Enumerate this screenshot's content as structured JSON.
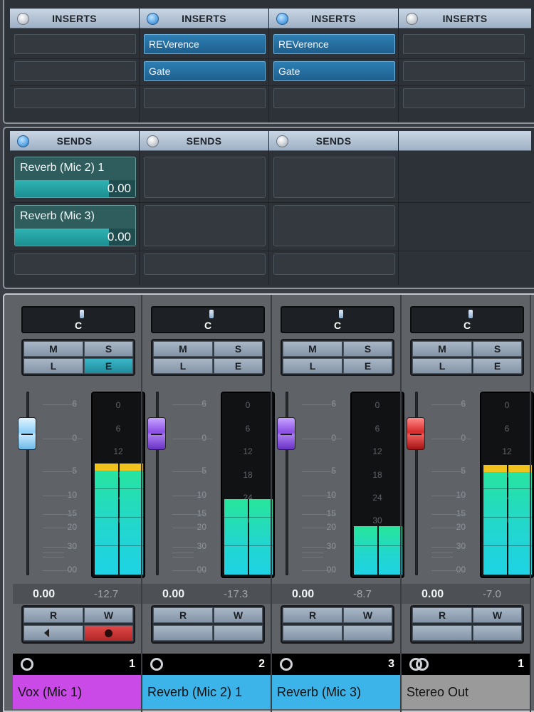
{
  "colors": {
    "insert_filled": "#2d7fb3",
    "send_fill": "#1c8f91",
    "meter_peak": "#f2c21c",
    "meter_level": "#22d6d0",
    "track_purple": "#c94ae6",
    "track_blue": "#3cb4ea",
    "track_grey": "#9a9a9a",
    "edit_active": "#1f8b9b",
    "record_active": "#d82a2a"
  },
  "inserts": {
    "channels": [
      {
        "header": "INSERTS",
        "active": false,
        "slots": [
          "",
          "",
          ""
        ]
      },
      {
        "header": "INSERTS",
        "active": true,
        "slots": [
          "REVerence",
          "Gate",
          ""
        ]
      },
      {
        "header": "INSERTS",
        "active": true,
        "slots": [
          "REVerence",
          "Gate",
          ""
        ]
      },
      {
        "header": "INSERTS",
        "active": false,
        "slots": [
          "",
          "",
          ""
        ]
      }
    ]
  },
  "sends": {
    "channels": [
      {
        "header": "SENDS",
        "active": true,
        "slots": [
          {
            "name": "Reverb (Mic 2)  1",
            "value": "0.00",
            "level": 0.78
          },
          {
            "name": "Reverb (Mic  3)",
            "value": "0.00",
            "level": 0.78
          }
        ]
      },
      {
        "header": "SENDS",
        "active": false,
        "slots": []
      },
      {
        "header": "SENDS",
        "active": false,
        "slots": []
      },
      {
        "header": "",
        "active": false,
        "slots": []
      }
    ]
  },
  "mixer": {
    "buttons": {
      "mute": "M",
      "solo": "S",
      "listen": "L",
      "edit": "E",
      "read": "R",
      "write": "W"
    },
    "fader_scale": [
      "6",
      "0",
      "5",
      "10",
      "15",
      "20",
      "30",
      "00"
    ],
    "meter_scale": [
      "0",
      "6",
      "12",
      "18",
      "24",
      "30"
    ],
    "strips": [
      {
        "pan": "C",
        "edit_active": true,
        "fader_color": "blue",
        "volume": "0.00",
        "peak": "-12.7",
        "meter_level": 0.62,
        "meter_peak_hold": true,
        "monitor_icon": "speaker-icon",
        "record_active": true,
        "number": "1",
        "type_icon": "mono-ring-icon",
        "name": "Vox (Mic 1)",
        "name_color": "#c94ae6"
      },
      {
        "pan": "C",
        "edit_active": false,
        "fader_color": "purple",
        "volume": "0.00",
        "peak": "-17.3",
        "meter_level": 0.42,
        "meter_peak_hold": false,
        "monitor_icon": "",
        "record_active": false,
        "number": "2",
        "type_icon": "mono-ring-icon",
        "name": "Reverb (Mic 2)  1",
        "name_color": "#3cb4ea"
      },
      {
        "pan": "C",
        "edit_active": false,
        "fader_color": "purple",
        "volume": "0.00",
        "peak": "-8.7",
        "meter_level": 0.27,
        "meter_peak_hold": false,
        "monitor_icon": "",
        "record_active": false,
        "number": "3",
        "type_icon": "mono-ring-icon",
        "name": "Reverb (Mic  3)",
        "name_color": "#3cb4ea"
      },
      {
        "pan": "C",
        "edit_active": false,
        "fader_color": "red",
        "volume": "0.00",
        "peak": "-7.0",
        "meter_level": 0.61,
        "meter_peak_hold": true,
        "monitor_icon": "",
        "record_active": false,
        "number": "1",
        "type_icon": "stereo-rings-icon",
        "name": "Stereo Out",
        "name_color": "#9a9a9a"
      }
    ]
  }
}
